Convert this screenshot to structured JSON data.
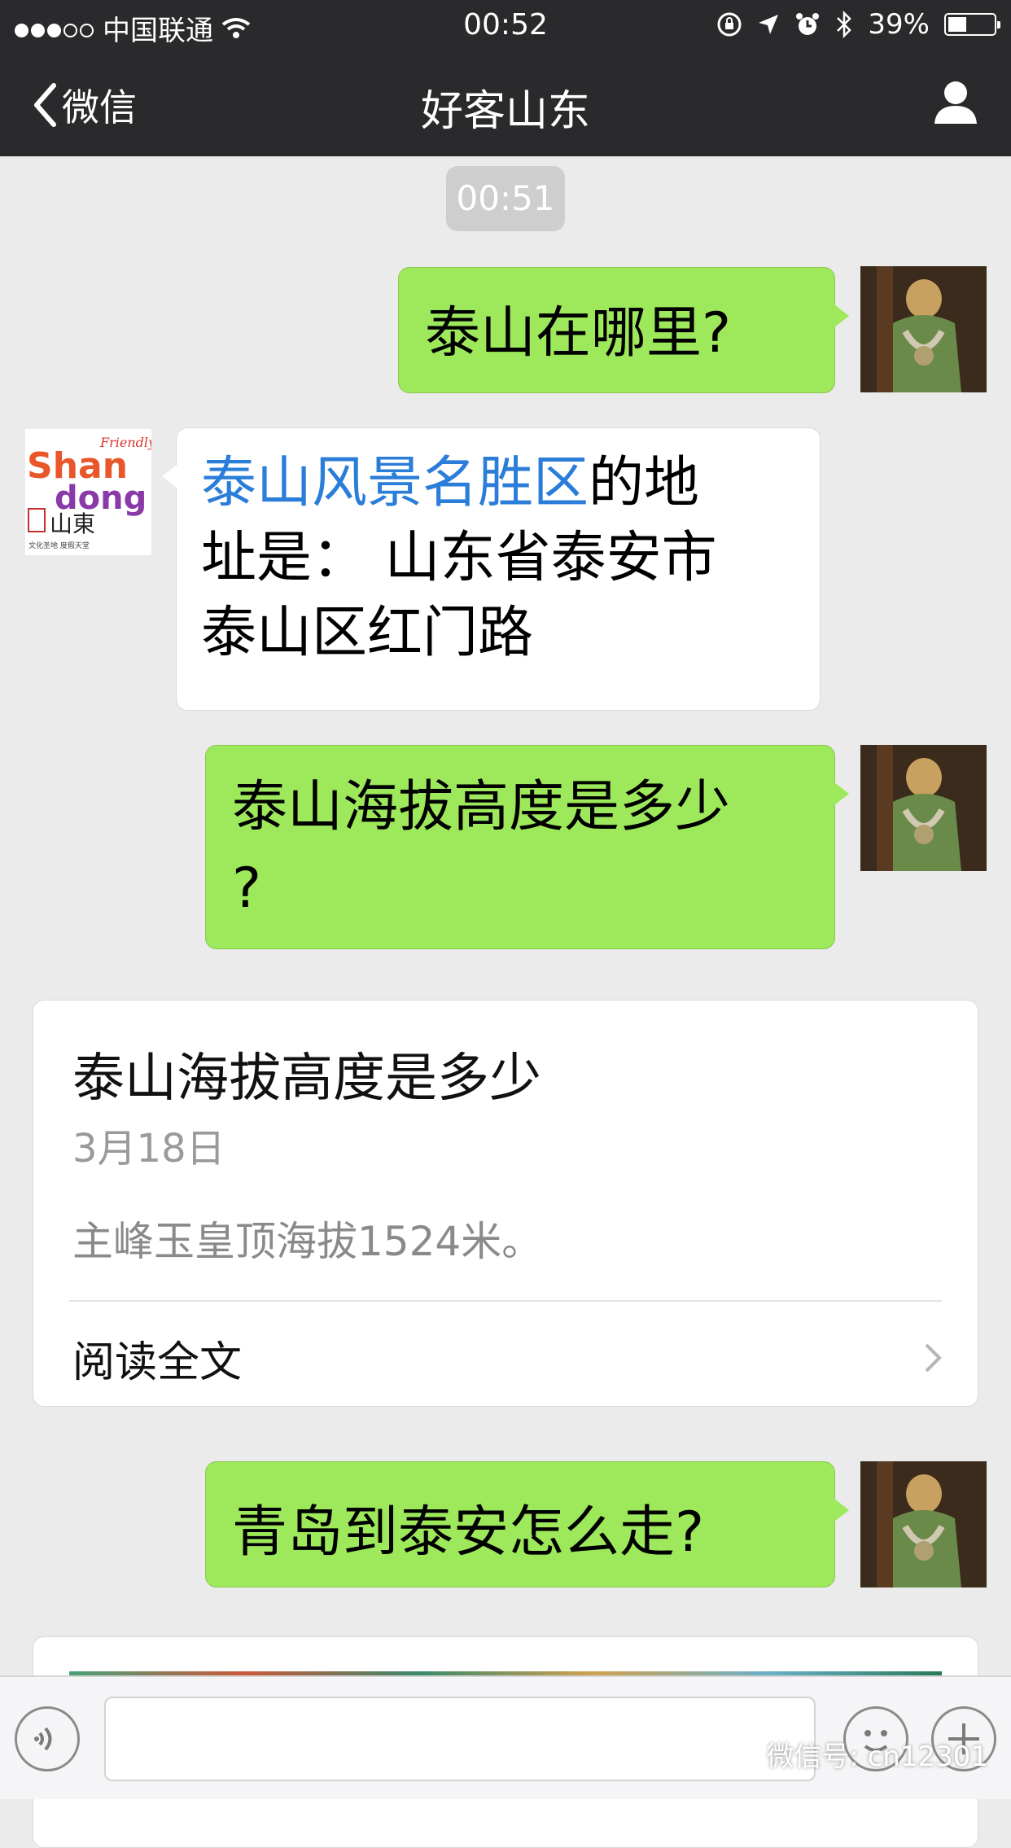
{
  "status_bar": {
    "carrier": "中国联通",
    "time": "00:52",
    "battery": "39%",
    "signal_dots": "●●●○○"
  },
  "nav": {
    "back_label": "微信",
    "title": "好客山东"
  },
  "timestamp": "00:51",
  "messages": [
    {
      "side": "right",
      "text": "泰山在哪里?"
    },
    {
      "side": "left",
      "link_text": "泰山风景名胜区",
      "line1_rest": "的地",
      "line2": "址是： 山东省泰安市",
      "line3": "泰山区红门路"
    },
    {
      "side": "right",
      "line1": "泰山海拔高度是多少",
      "line2": "?"
    },
    {
      "side": "right",
      "text": "青岛到泰安怎么走?"
    }
  ],
  "article_card": {
    "title": "泰山海拔高度是多少",
    "date": "3月18日",
    "summary": "主峰玉皇顶海拔1524米。",
    "read_more": "阅读全文"
  },
  "logo": {
    "line1": "Shan",
    "line2": "dong",
    "friendly": "Friendly",
    "chars": "山東",
    "sub": "文化圣地 度假天堂"
  },
  "watermark": "微信号: cn12301",
  "colors": {
    "header_bg": "#2a2a2c",
    "chat_bg": "#ebebeb",
    "sent_bubble": "#9de95b",
    "link": "#2a7dd8"
  },
  "icons": [
    "chevron-left-icon",
    "person-icon",
    "voice-icon",
    "emoji-icon",
    "plus-icon",
    "wifi-icon",
    "location-arrow-icon",
    "alarm-icon",
    "bluetooth-icon",
    "lock-rotation-icon"
  ]
}
